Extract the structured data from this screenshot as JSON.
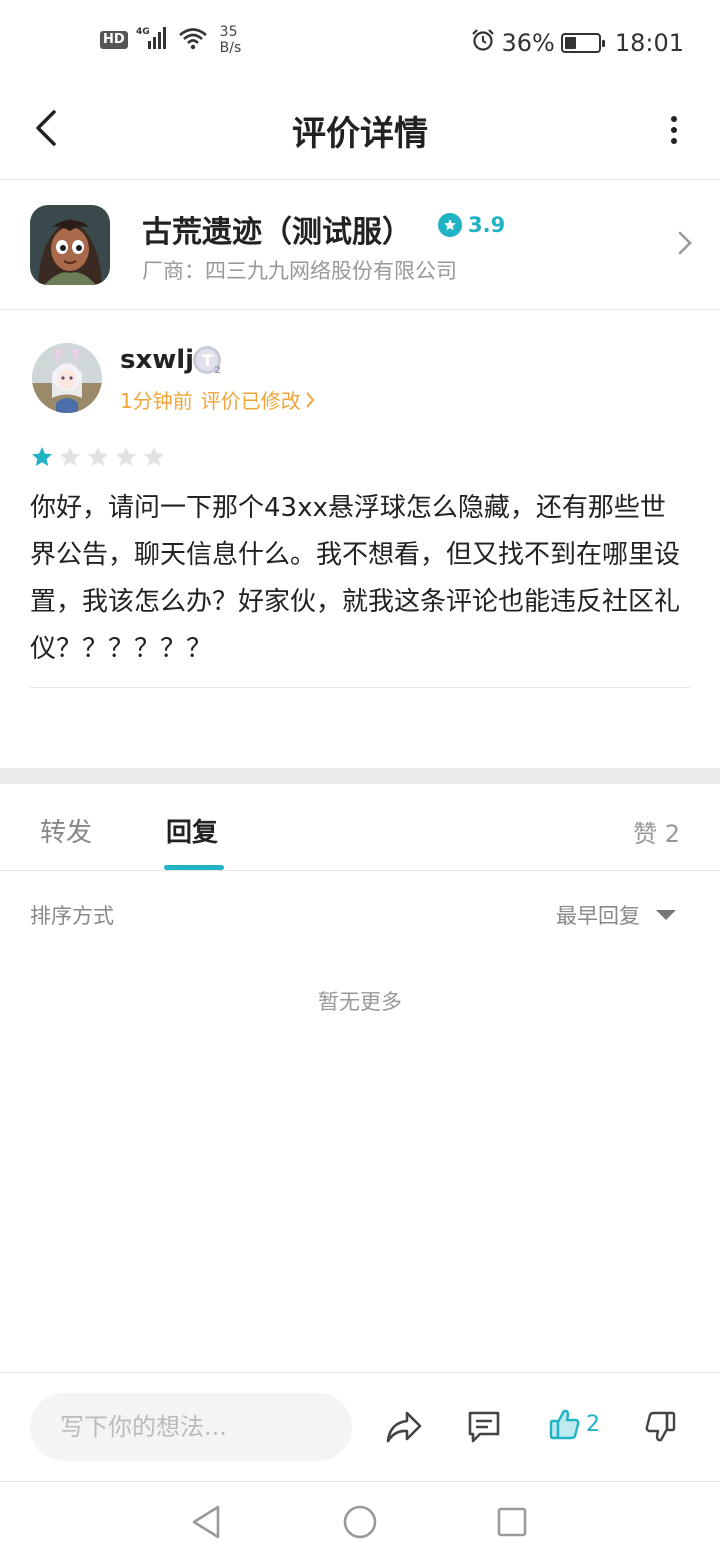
{
  "status_bar": {
    "hd": "HD",
    "network": "4G",
    "speed_value": "35",
    "speed_unit": "B/s",
    "battery": "36%",
    "battery_level": 0.36,
    "time": "18:01"
  },
  "header": {
    "title": "评价详情"
  },
  "app": {
    "name": "古荒遗迹（测试服）",
    "rating": "3.9",
    "vendor": "厂商：四三九九网络股份有限公司"
  },
  "review": {
    "username": "sxwlj",
    "time": "1分钟前",
    "edited": "评价已修改",
    "stars": 1,
    "stars_total": 5,
    "text": "你好，请问一下那个43xx悬浮球怎么隐藏，还有那些世界公告，聊天信息什么。我不想看，但又找不到在哪里设置，我该怎么办？好家伙，就我这条评论也能违反社区礼仪？？？？？？"
  },
  "tabs": {
    "forward": "转发",
    "reply": "回复",
    "likes": "赞 2"
  },
  "sort": {
    "label": "排序方式",
    "selected": "最早回复"
  },
  "empty_text": "暂无更多",
  "bottom_bar": {
    "placeholder": "写下你的想法...",
    "like_count": "2"
  },
  "colors": {
    "accent": "#1fb3c4",
    "meta": "#f0a53a"
  }
}
